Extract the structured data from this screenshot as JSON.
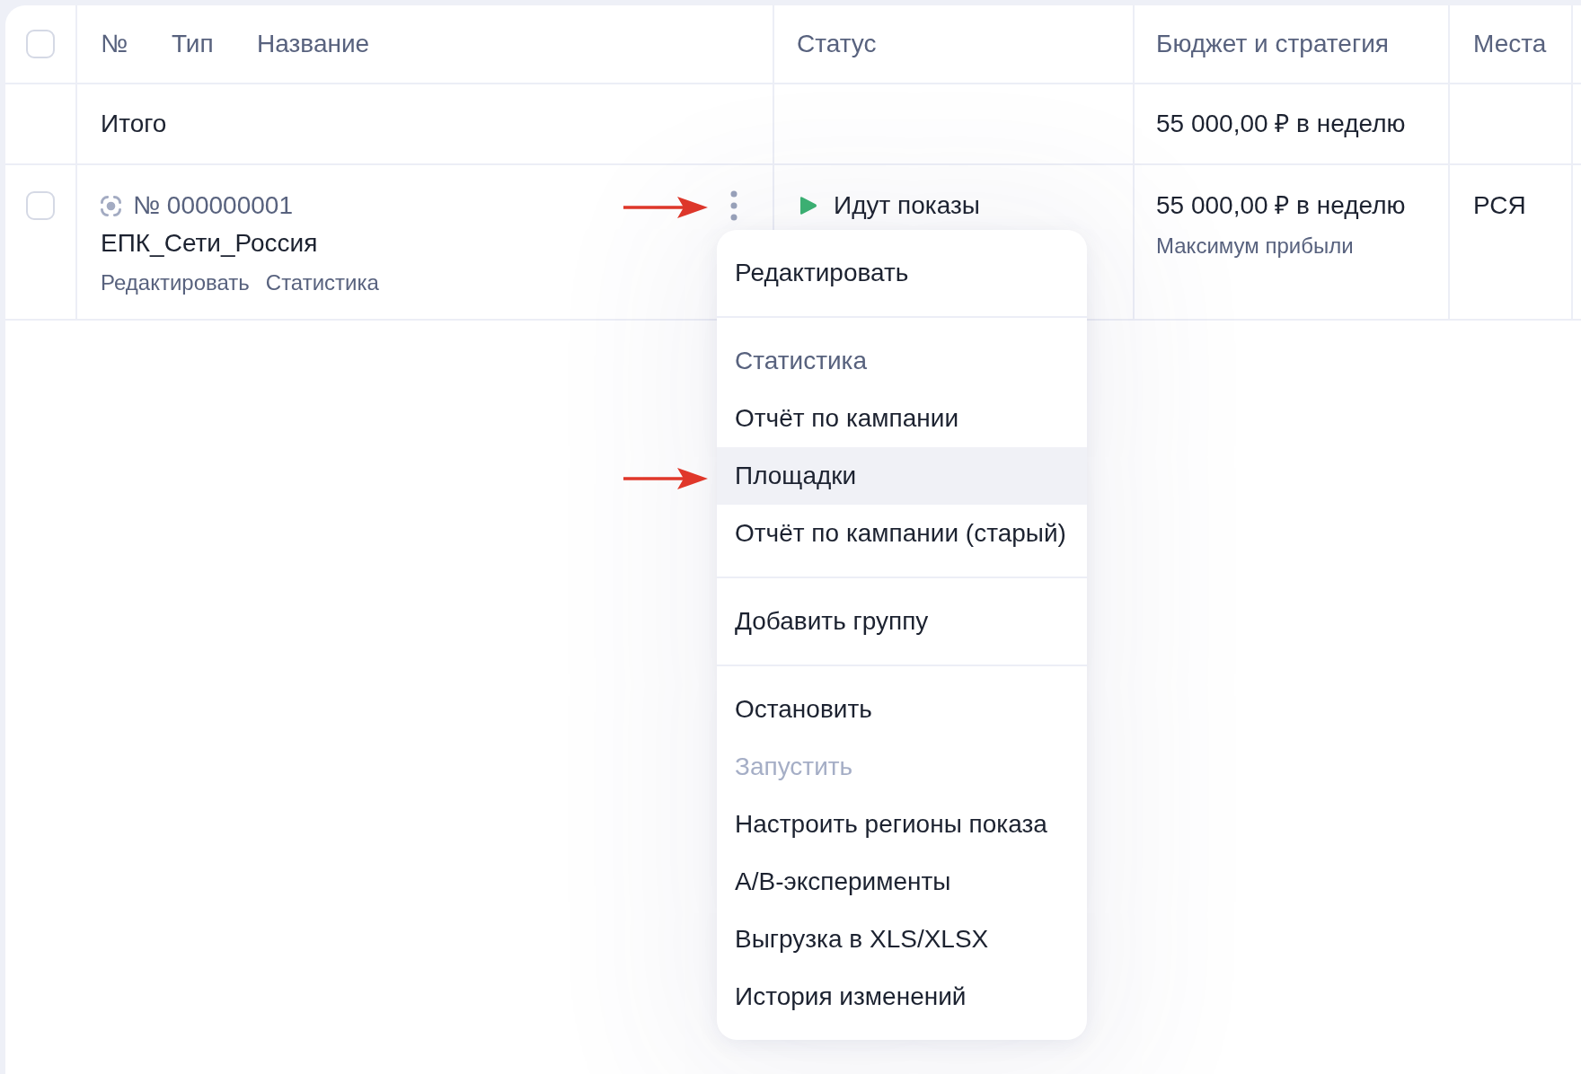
{
  "table": {
    "select_all": {
      "checked": false
    },
    "columns": [
      "№",
      "Тип",
      "Название",
      "Статус",
      "Бюджет и стратегия",
      "Места"
    ],
    "total_row": {
      "label": "Итого",
      "budget": "55 000,00 ₽ в неделю"
    },
    "rows": [
      {
        "checked": false,
        "number": "№ 000000001",
        "name": "ЕПК_Сети_Россия",
        "links": [
          "Редактировать",
          "Статистика"
        ],
        "status": {
          "kind": "running",
          "label": "Идут показы"
        },
        "budget": "55 000,00 ₽ в неделю",
        "strategy": "Максимум прибыли",
        "places": "РСЯ"
      }
    ]
  },
  "context_menu": {
    "sections": [
      {
        "items": [
          {
            "label": "Редактировать",
            "kind": "action",
            "selected": false,
            "disabled": false
          }
        ]
      },
      {
        "items": [
          {
            "label": "Статистика",
            "kind": "heading",
            "selected": false,
            "disabled": false
          },
          {
            "label": "Отчёт по кампании",
            "kind": "action",
            "selected": false,
            "disabled": false
          },
          {
            "label": "Площадки",
            "kind": "action",
            "selected": true,
            "disabled": false
          },
          {
            "label": "Отчёт по кампании (старый)",
            "kind": "action",
            "selected": false,
            "disabled": false
          }
        ]
      },
      {
        "items": [
          {
            "label": "Добавить группу",
            "kind": "action",
            "selected": false,
            "disabled": false
          }
        ]
      },
      {
        "items": [
          {
            "label": "Остановить",
            "kind": "action",
            "selected": false,
            "disabled": false
          },
          {
            "label": "Запустить",
            "kind": "action",
            "selected": false,
            "disabled": true
          },
          {
            "label": "Настроить регионы показа",
            "kind": "action",
            "selected": false,
            "disabled": false
          },
          {
            "label": "A/B-эксперименты",
            "kind": "action",
            "selected": false,
            "disabled": false
          },
          {
            "label": "Выгрузка в XLS/XLSX",
            "kind": "action",
            "selected": false,
            "disabled": false
          },
          {
            "label": "История изменений",
            "kind": "action",
            "selected": false,
            "disabled": false
          }
        ]
      }
    ]
  }
}
